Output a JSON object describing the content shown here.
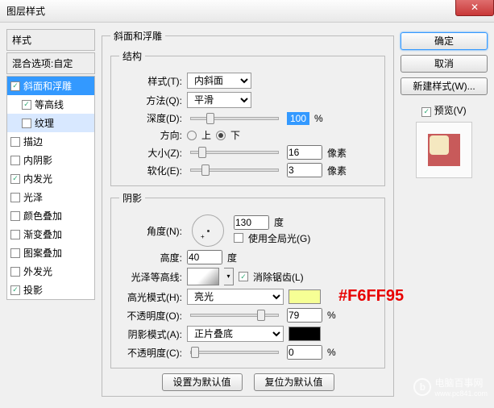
{
  "title": "图层样式",
  "sidebar": {
    "header": "样式",
    "blend": "混合选项:自定",
    "items": [
      {
        "label": "斜面和浮雕",
        "checked": true,
        "selected": true
      },
      {
        "label": "等高线",
        "checked": true,
        "sub": true
      },
      {
        "label": "纹理",
        "checked": false,
        "sub": true,
        "alt": true
      },
      {
        "label": "描边",
        "checked": false
      },
      {
        "label": "内阴影",
        "checked": false
      },
      {
        "label": "内发光",
        "checked": true
      },
      {
        "label": "光泽",
        "checked": false
      },
      {
        "label": "颜色叠加",
        "checked": false
      },
      {
        "label": "渐变叠加",
        "checked": false
      },
      {
        "label": "图案叠加",
        "checked": false
      },
      {
        "label": "外发光",
        "checked": false
      },
      {
        "label": "投影",
        "checked": true
      }
    ]
  },
  "panel": {
    "group_main": "斜面和浮雕",
    "group_struct": "结构",
    "style_lbl": "样式(T):",
    "style_val": "内斜面",
    "tech_lbl": "方法(Q):",
    "tech_val": "平滑",
    "depth_lbl": "深度(D):",
    "depth_val": "100",
    "pct": "%",
    "dir_lbl": "方向:",
    "dir_up": "上",
    "dir_down": "下",
    "size_lbl": "大小(Z):",
    "size_val": "16",
    "px": "像素",
    "soft_lbl": "软化(E):",
    "soft_val": "3",
    "group_shade": "阴影",
    "angle_lbl": "角度(N):",
    "angle_val": "130",
    "deg": "度",
    "global_lbl": "使用全局光(G)",
    "alt_lbl": "高度:",
    "alt_val": "40",
    "gloss_lbl": "光泽等高线:",
    "aa_lbl": "消除锯齿(L)",
    "hmode_lbl": "高光模式(H):",
    "hmode_val": "亮光",
    "hop_lbl": "不透明度(O):",
    "hop_val": "79",
    "smode_lbl": "阴影模式(A):",
    "smode_val": "正片叠底",
    "sop_lbl": "不透明度(C):",
    "sop_val": "0",
    "btn_default": "设置为默认值",
    "btn_reset": "复位为默认值",
    "hcolor": "#F6FF95"
  },
  "right": {
    "ok": "确定",
    "cancel": "取消",
    "newstyle": "新建样式(W)...",
    "preview": "预览(V)"
  },
  "annotation": "#F6FF95",
  "watermark": "电脑百事网",
  "watermark_url": "www.pc841.com"
}
